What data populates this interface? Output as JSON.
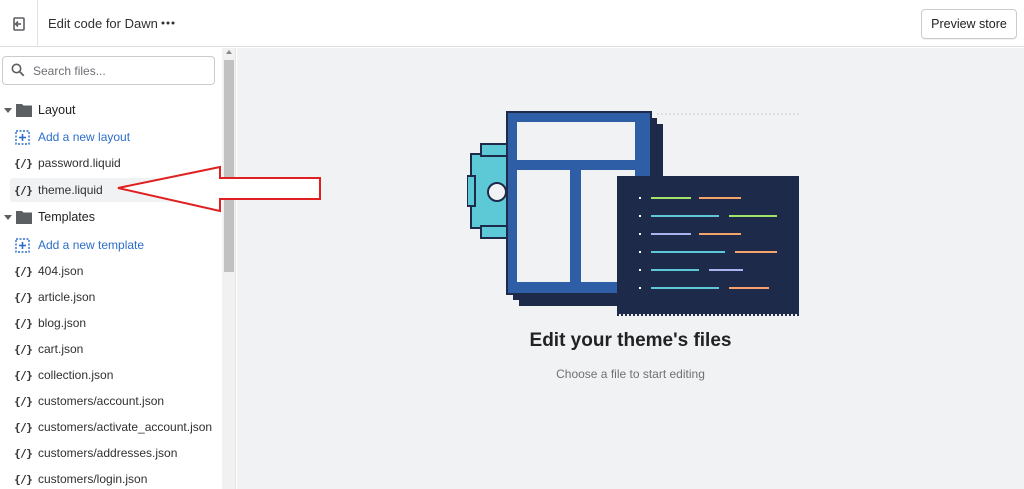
{
  "topbar": {
    "title": "Edit code for Dawn",
    "more_label": "•••",
    "preview_label": "Preview store"
  },
  "sidebar": {
    "search_placeholder": "Search files...",
    "folders": [
      {
        "label": "Layout",
        "add_label": "Add a new layout",
        "files": [
          "password.liquid",
          "theme.liquid"
        ],
        "selected": "theme.liquid"
      },
      {
        "label": "Templates",
        "add_label": "Add a new template",
        "files": [
          "404.json",
          "article.json",
          "blog.json",
          "cart.json",
          "collection.json",
          "customers/account.json",
          "customers/activate_account.json",
          "customers/addresses.json",
          "customers/login.json"
        ]
      }
    ],
    "file_icon_glyph": "{/}"
  },
  "main": {
    "empty_title": "Edit your theme's files",
    "empty_subtitle": "Choose a file to start editing"
  },
  "colors": {
    "accent_link": "#2c6ecb",
    "annotation_arrow": "#e02020",
    "code_panel": "#1e2a4a",
    "gear": "#5ec9d6",
    "template_blue": "#2d5ea6"
  },
  "icons": {
    "exit": "exit-icon",
    "more": "more-horizontal-icon",
    "search": "search-icon",
    "folder": "folder-icon",
    "caret": "caret-down-icon",
    "file": "liquid-file-icon",
    "add": "add-file-icon"
  }
}
